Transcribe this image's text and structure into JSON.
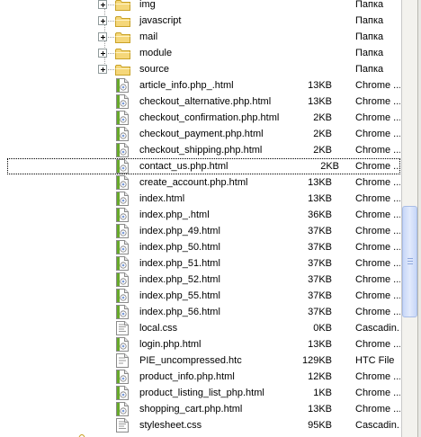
{
  "rows": [
    {
      "kind": "folder",
      "name": "img",
      "size": "",
      "type": "Папка"
    },
    {
      "kind": "folder",
      "name": "javascript",
      "size": "",
      "type": "Папка"
    },
    {
      "kind": "folder",
      "name": "mail",
      "size": "",
      "type": "Папка"
    },
    {
      "kind": "folder",
      "name": "module",
      "size": "",
      "type": "Папка"
    },
    {
      "kind": "folder",
      "name": "source",
      "size": "",
      "type": "Папка"
    },
    {
      "kind": "html",
      "name": "article_info.php_.html",
      "size": "13KB",
      "type": "Chrome ..."
    },
    {
      "kind": "html",
      "name": "checkout_alternative.php.html",
      "size": "13KB",
      "type": "Chrome ..."
    },
    {
      "kind": "html",
      "name": "checkout_confirmation.php.html",
      "size": "2KB",
      "type": "Chrome ..."
    },
    {
      "kind": "html",
      "name": "checkout_payment.php.html",
      "size": "2KB",
      "type": "Chrome ..."
    },
    {
      "kind": "html",
      "name": "checkout_shipping.php.html",
      "size": "2KB",
      "type": "Chrome ..."
    },
    {
      "kind": "html",
      "name": "contact_us.php.html",
      "size": "2KB",
      "type": "Chrome ...",
      "focused": true
    },
    {
      "kind": "html",
      "name": "create_account.php.html",
      "size": "13KB",
      "type": "Chrome ..."
    },
    {
      "kind": "html",
      "name": "index.html",
      "size": "13KB",
      "type": "Chrome ..."
    },
    {
      "kind": "html",
      "name": "index.php_.html",
      "size": "36KB",
      "type": "Chrome ..."
    },
    {
      "kind": "html",
      "name": "index.php_49.html",
      "size": "37KB",
      "type": "Chrome ..."
    },
    {
      "kind": "html",
      "name": "index.php_50.html",
      "size": "37KB",
      "type": "Chrome ..."
    },
    {
      "kind": "html",
      "name": "index.php_51.html",
      "size": "37KB",
      "type": "Chrome ..."
    },
    {
      "kind": "html",
      "name": "index.php_52.html",
      "size": "37KB",
      "type": "Chrome ..."
    },
    {
      "kind": "html",
      "name": "index.php_55.html",
      "size": "37KB",
      "type": "Chrome ..."
    },
    {
      "kind": "html",
      "name": "index.php_56.html",
      "size": "37KB",
      "type": "Chrome ..."
    },
    {
      "kind": "css",
      "name": "local.css",
      "size": "0KB",
      "type": "Cascadin..."
    },
    {
      "kind": "html",
      "name": "login.php.html",
      "size": "13KB",
      "type": "Chrome ..."
    },
    {
      "kind": "htc",
      "name": "PIE_uncompressed.htc",
      "size": "129KB",
      "type": "HTC File"
    },
    {
      "kind": "html",
      "name": "product_info.php.html",
      "size": "12KB",
      "type": "Chrome ..."
    },
    {
      "kind": "html",
      "name": "product_listing_list_php.html",
      "size": "1KB",
      "type": "Chrome ..."
    },
    {
      "kind": "html",
      "name": "shopping_cart.php.html",
      "size": "13KB",
      "type": "Chrome ..."
    },
    {
      "kind": "css",
      "name": "stylesheet.css",
      "size": "95KB",
      "type": "Cascadin..."
    }
  ],
  "icons": {
    "folder": "folder-icon",
    "html": "html-file-icon",
    "css": "css-file-icon",
    "htc": "htc-file-icon",
    "expander": "plus-expander-icon"
  },
  "colors": {
    "folder_fill": "#f5d77a",
    "folder_edge": "#c9a227",
    "chrome_green": "#4e9a06",
    "scroll_thumb": "#c6d6f8"
  },
  "scrollbar": {
    "thumb_label": "≡"
  }
}
